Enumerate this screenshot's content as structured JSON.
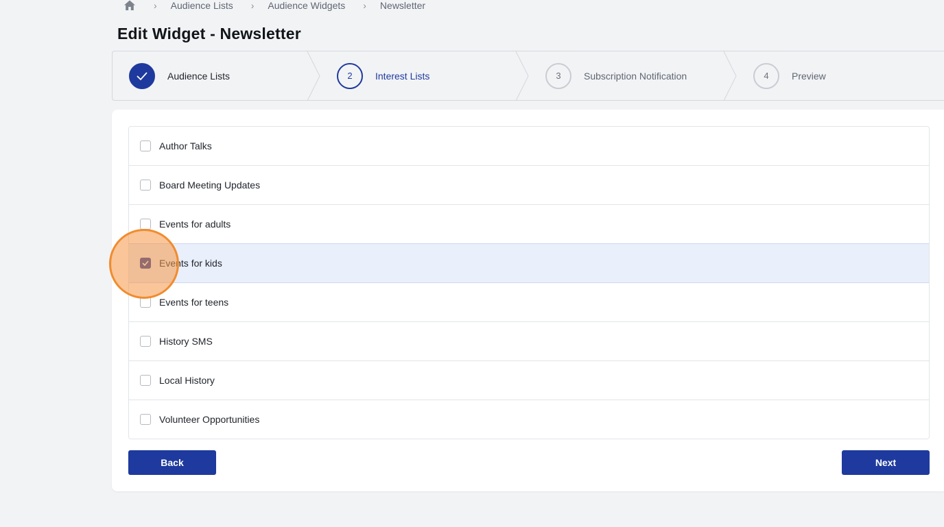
{
  "breadcrumb": {
    "home_icon": "home-icon",
    "items": [
      "Audience Lists",
      "Audience Widgets",
      "Newsletter"
    ]
  },
  "page": {
    "title": "Edit Widget - Newsletter"
  },
  "stepper": {
    "steps": [
      {
        "number": "",
        "label": "Audience Lists",
        "state": "done",
        "icon": "check-icon"
      },
      {
        "number": "2",
        "label": "Interest Lists",
        "state": "current"
      },
      {
        "number": "3",
        "label": "Subscription Notification",
        "state": "upcoming"
      },
      {
        "number": "4",
        "label": "Preview",
        "state": "upcoming"
      }
    ]
  },
  "interest_lists": {
    "items": [
      {
        "label": "Author Talks",
        "checked": false
      },
      {
        "label": "Board Meeting Updates",
        "checked": false
      },
      {
        "label": "Events for adults",
        "checked": false
      },
      {
        "label": "Events for kids",
        "checked": true
      },
      {
        "label": "Events for teens",
        "checked": false
      },
      {
        "label": "History SMS",
        "checked": false
      },
      {
        "label": "Local History",
        "checked": false
      },
      {
        "label": "Volunteer Opportunities",
        "checked": false
      }
    ]
  },
  "actions": {
    "back_label": "Back",
    "next_label": "Next"
  },
  "colors": {
    "primary": "#1e3a9e",
    "selected_row": "#e9effb",
    "background": "#f2f3f5",
    "click_highlight": "#f08c2e"
  }
}
